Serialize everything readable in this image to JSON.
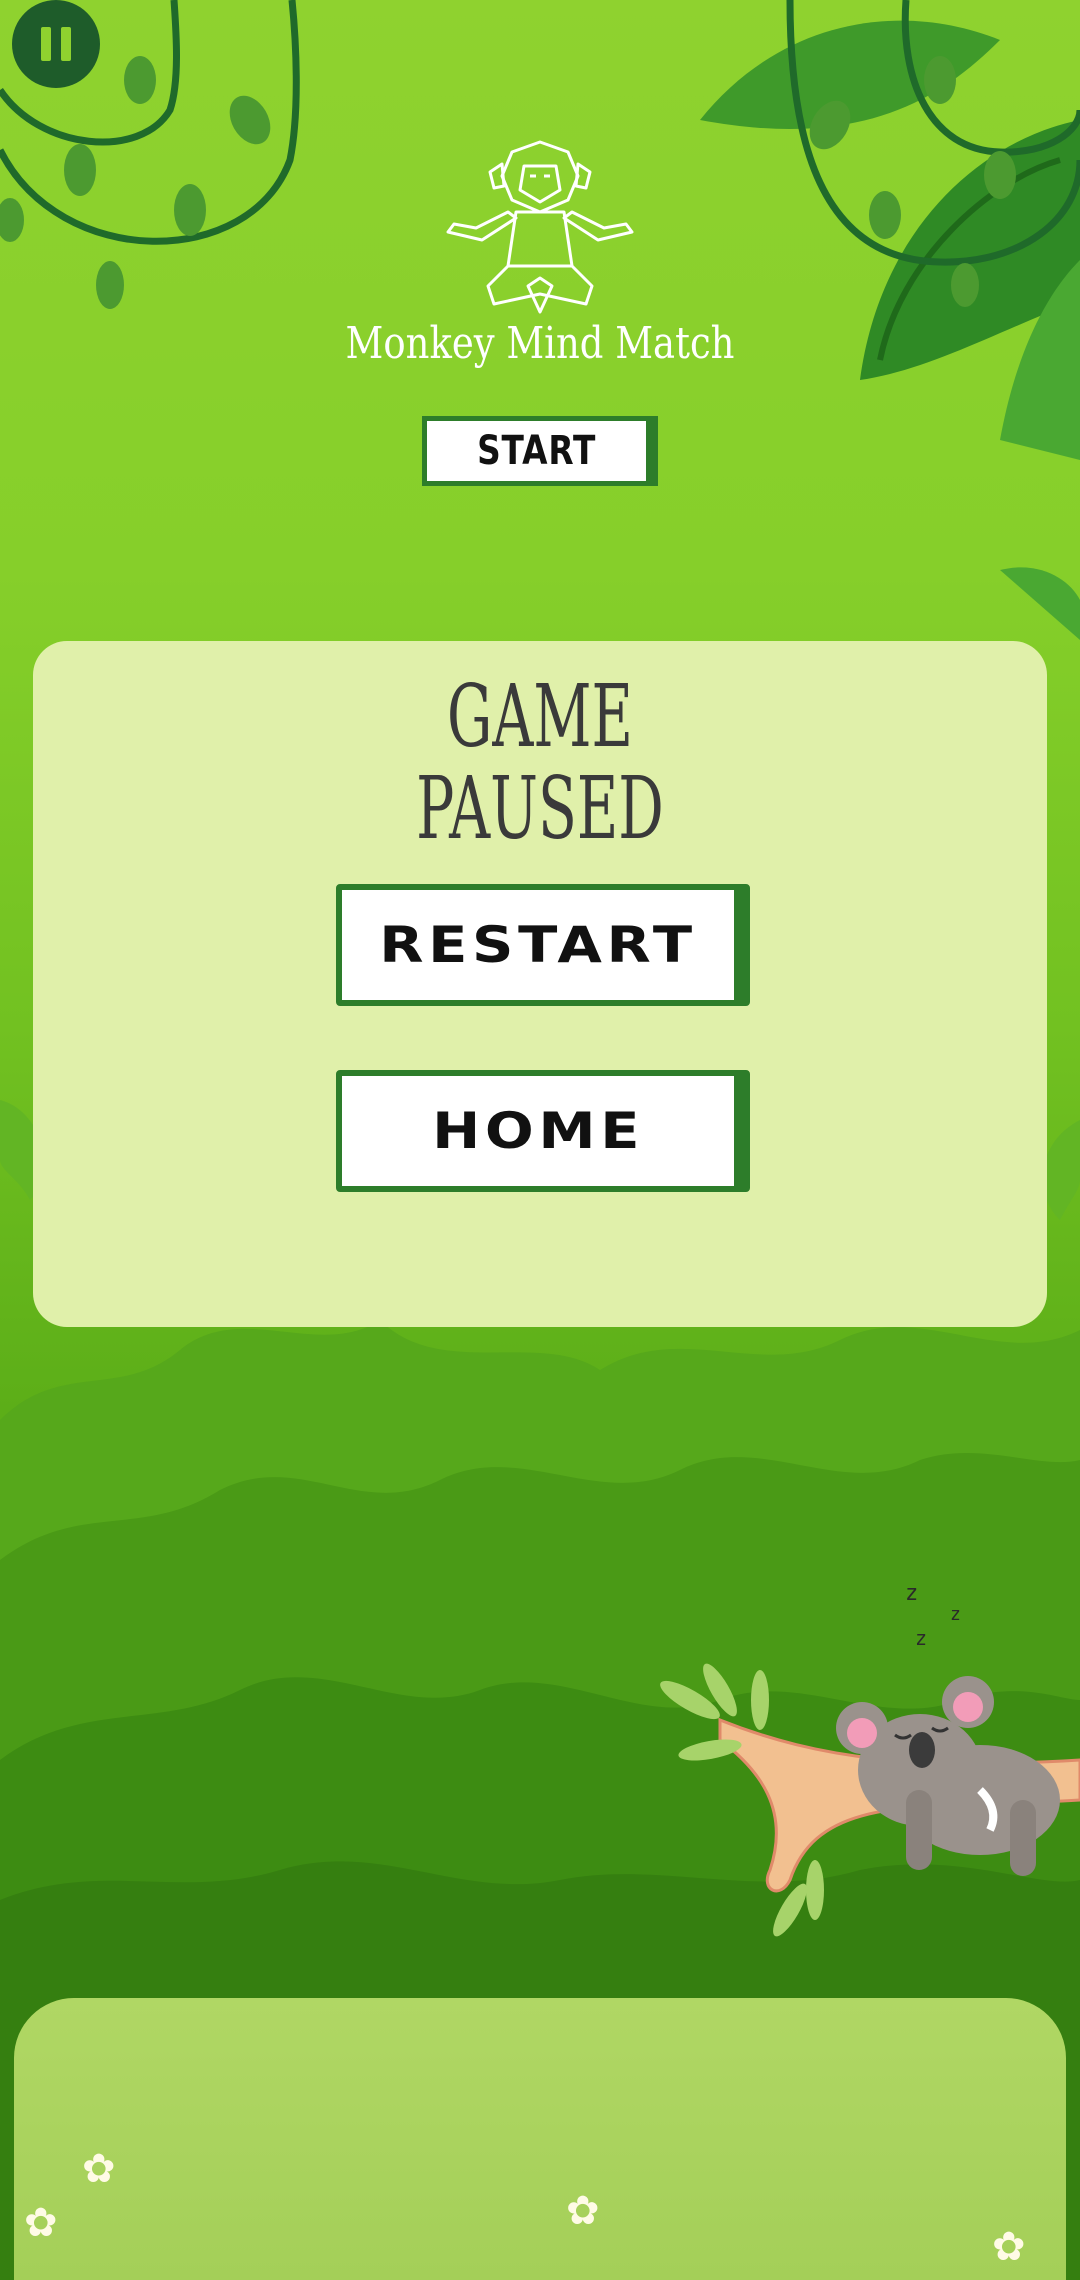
{
  "game": {
    "title": "Monkey Mind Match",
    "start_label": "START"
  },
  "pause_dialog": {
    "title_line1": "GAME",
    "title_line2": "PAUSED",
    "restart_label": "RESTART",
    "home_label": "HOME"
  },
  "decor": {
    "sleep_text": "z z z"
  },
  "colors": {
    "sky_top": "#8fd22f",
    "panel_bg": "#e0f0aa",
    "button_border": "#2d7d2a",
    "pause_button": "#1e5c2a"
  }
}
